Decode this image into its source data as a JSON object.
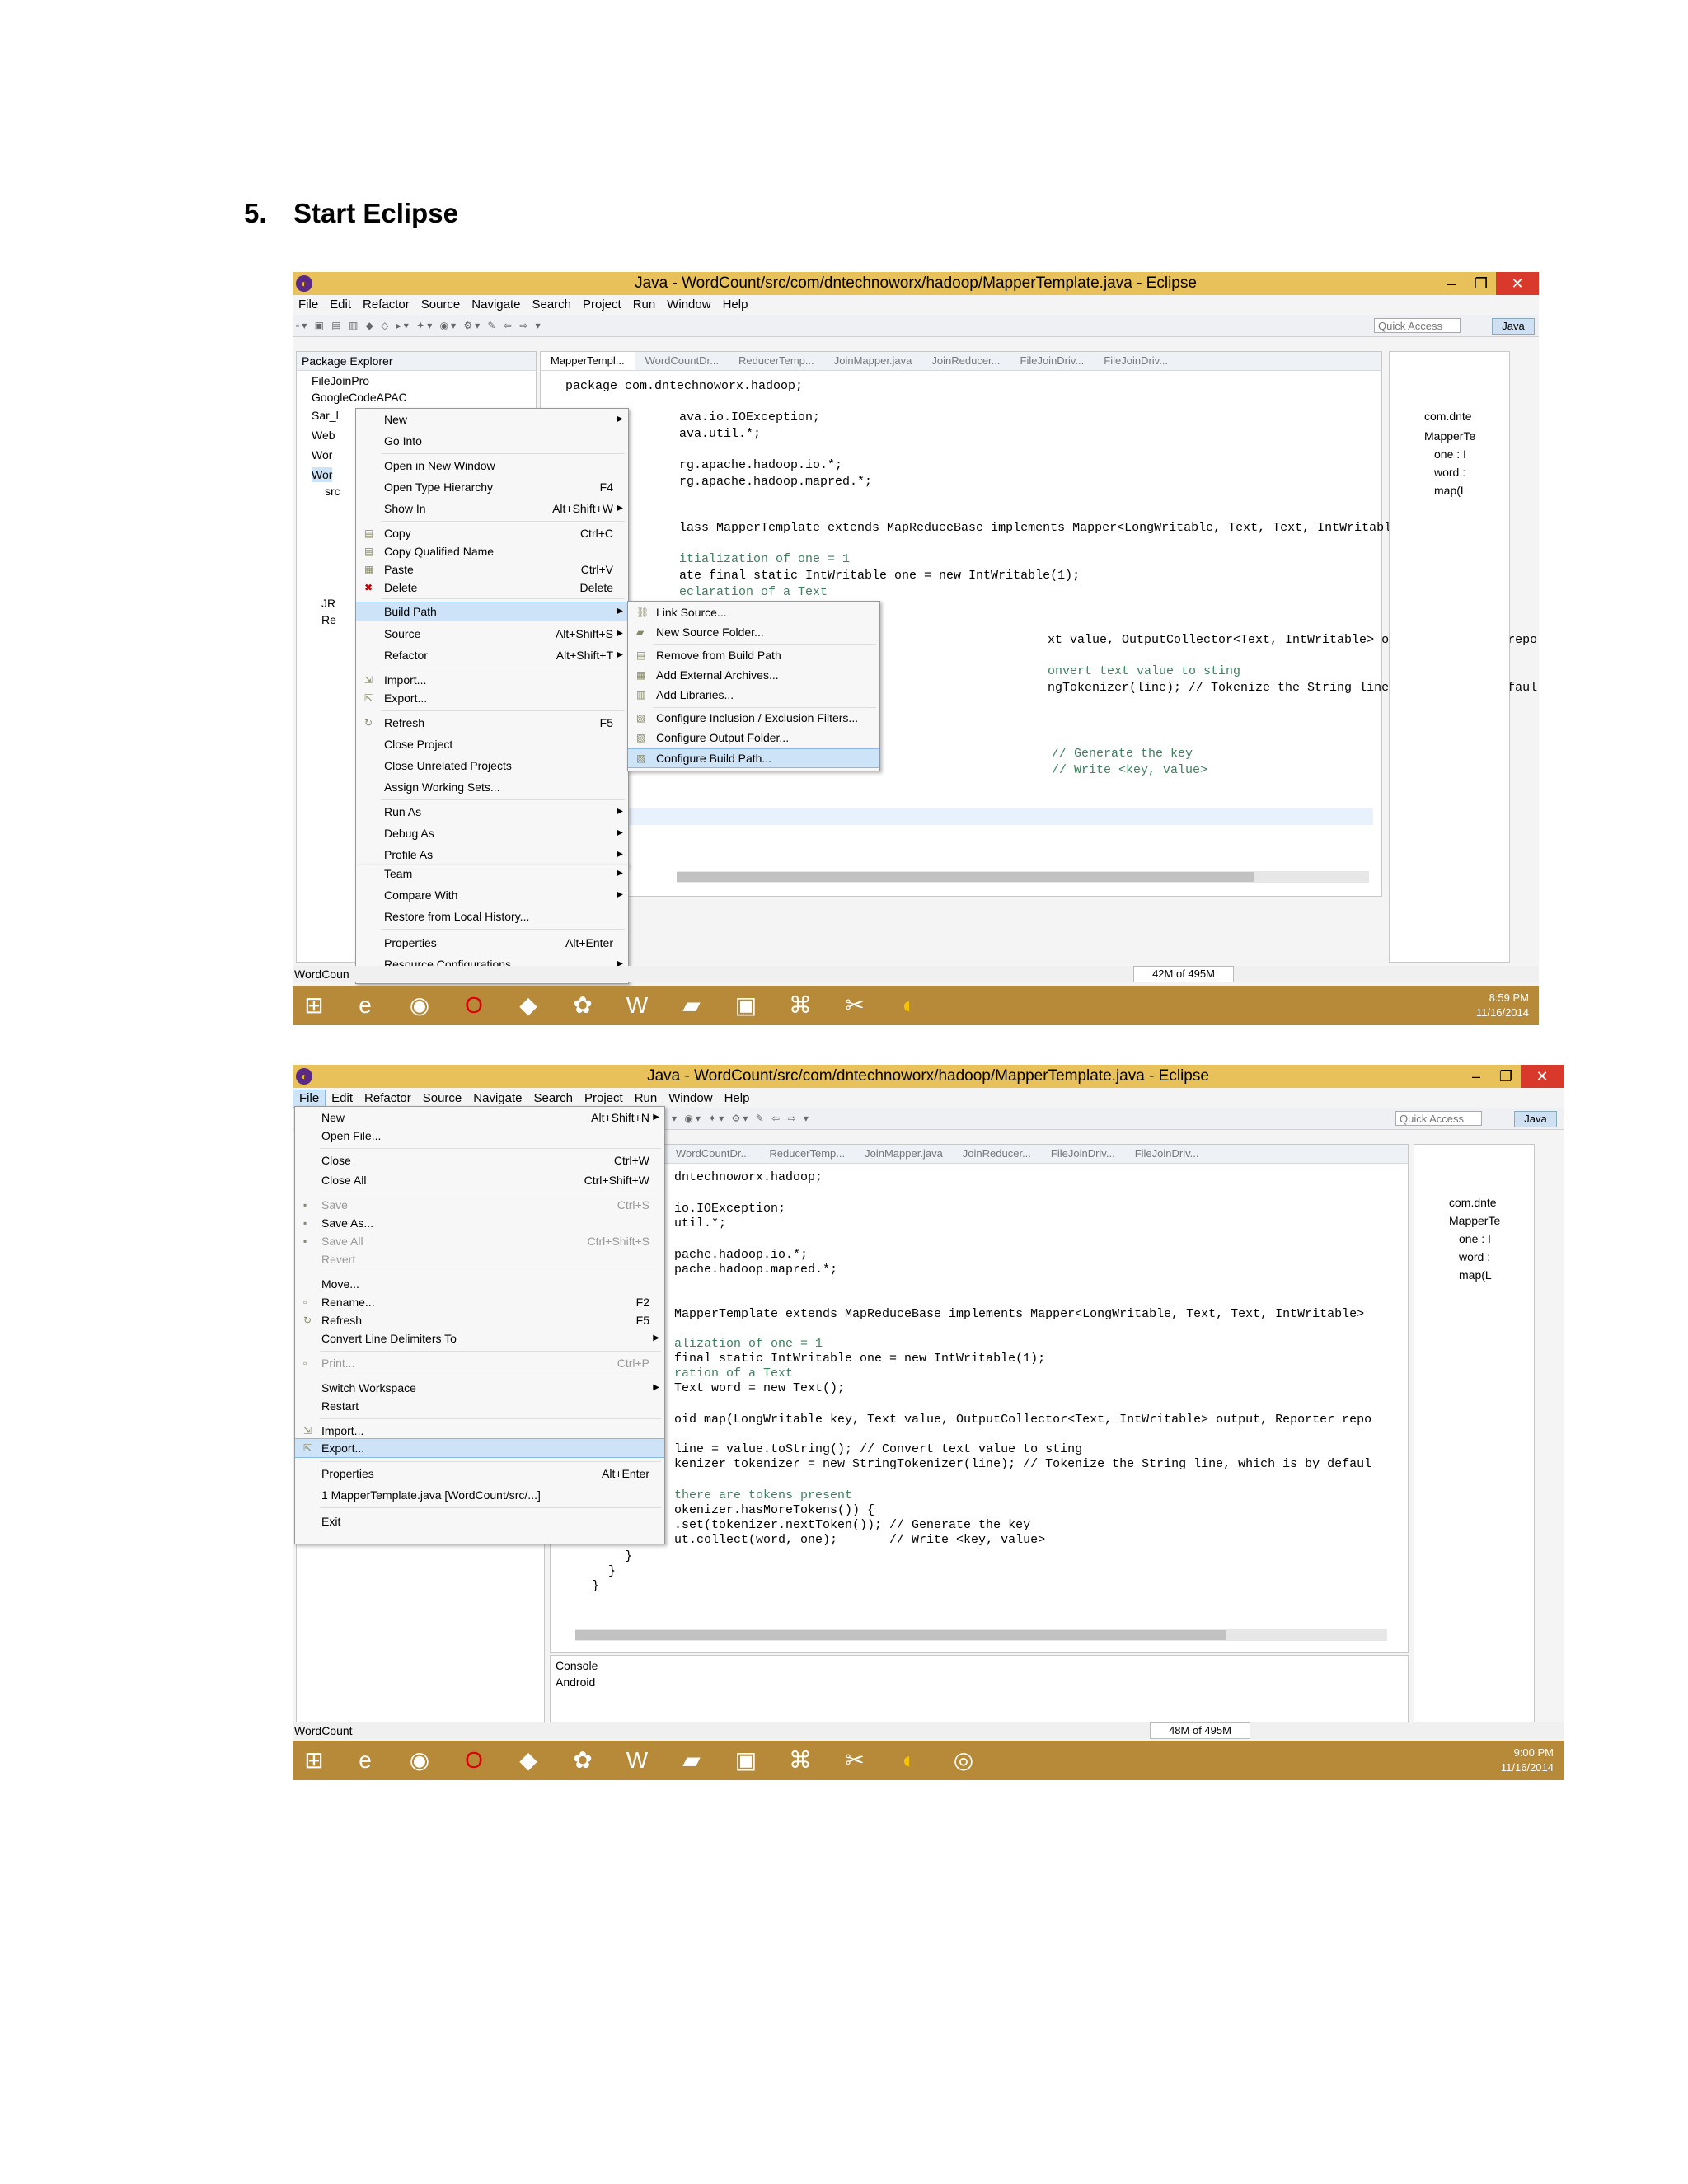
{
  "heading": {
    "number": "5.",
    "text": "Start Eclipse"
  },
  "shot1": {
    "title": "Java - WordCount/src/com/dntechnoworx/hadoop/MapperTemplate.java - Eclipse",
    "menubar": [
      "File",
      "Edit",
      "Refactor",
      "Source",
      "Navigate",
      "Search",
      "Project",
      "Run",
      "Window",
      "Help"
    ],
    "quick_access": "Quick Access",
    "perspective": "Java",
    "package_explorer": "Package Explorer",
    "tree": [
      "FileJoinPro",
      "GoogleCodeAPAC",
      "Sar_l",
      "Web",
      "Wor",
      "Wor",
      "src",
      "JR",
      "Re"
    ],
    "tabs": [
      "MapperTempl...",
      "WordCountDr...",
      "ReducerTemp...",
      "JoinMapper.java",
      "JoinReducer...",
      "FileJoinDriv...",
      "FileJoinDriv..."
    ],
    "code": [
      "package com.dntechnoworx.hadoop;",
      "ava.io.IOException;",
      "ava.util.*;",
      "rg.apache.hadoop.io.*;",
      "rg.apache.hadoop.mapred.*;",
      "lass MapperTemplate extends MapReduceBase implements Mapper<LongWritable, Text, Text, IntWritable>",
      "itialization of one = 1",
      "ate final static IntWritable one = new IntWritable(1);",
      "eclaration of a Text",
      "xt value, OutputCollector<Text, IntWritable> output, Reporter repo",
      "onvert text value to sting",
      "ngTokenizer(line); // Tokenize the String line, which is by defaul",
      "// Generate the key",
      "// Write <key, value>"
    ],
    "context_menu": [
      {
        "label": "New",
        "shortcut": "",
        "submenu": true
      },
      {
        "label": "Go Into",
        "shortcut": ""
      },
      {
        "label": "Open in New Window",
        "shortcut": ""
      },
      {
        "label": "Open Type Hierarchy",
        "shortcut": "F4"
      },
      {
        "label": "Show In",
        "shortcut": "Alt+Shift+W",
        "submenu": true
      },
      {
        "label": "Copy",
        "shortcut": "Ctrl+C"
      },
      {
        "label": "Copy Qualified Name",
        "shortcut": ""
      },
      {
        "label": "Paste",
        "shortcut": "Ctrl+V"
      },
      {
        "label": "Delete",
        "shortcut": "Delete"
      },
      {
        "label": "Build Path",
        "shortcut": "",
        "submenu": true
      },
      {
        "label": "Source",
        "shortcut": "Alt+Shift+S",
        "submenu": true
      },
      {
        "label": "Refactor",
        "shortcut": "Alt+Shift+T",
        "submenu": true
      },
      {
        "label": "Import...",
        "shortcut": ""
      },
      {
        "label": "Export...",
        "shortcut": ""
      },
      {
        "label": "Refresh",
        "shortcut": "F5"
      },
      {
        "label": "Close Project",
        "shortcut": ""
      },
      {
        "label": "Close Unrelated Projects",
        "shortcut": ""
      },
      {
        "label": "Assign Working Sets...",
        "shortcut": ""
      },
      {
        "label": "Run As",
        "shortcut": "",
        "submenu": true
      },
      {
        "label": "Debug As",
        "shortcut": "",
        "submenu": true
      },
      {
        "label": "Profile As",
        "shortcut": "",
        "submenu": true
      },
      {
        "label": "Team",
        "shortcut": "",
        "submenu": true
      },
      {
        "label": "Compare With",
        "shortcut": "",
        "submenu": true
      },
      {
        "label": "Restore from Local History...",
        "shortcut": ""
      },
      {
        "label": "Properties",
        "shortcut": "Alt+Enter"
      },
      {
        "label": "Resource Configurations",
        "shortcut": "",
        "submenu": true
      }
    ],
    "build_path_menu": [
      "Link Source...",
      "New Source Folder...",
      "Remove from Build Path",
      "Add External Archives...",
      "Add Libraries...",
      "Configure Inclusion / Exclusion Filters...",
      "Configure Output Folder...",
      "Configure Build Path..."
    ],
    "outline": [
      "com.dnte",
      "MapperTe",
      "one : I",
      "word :",
      "map(L"
    ],
    "status_left": "WordCoun",
    "memory": "42M of 495M",
    "clock_time": "8:59 PM",
    "clock_date": "11/16/2014"
  },
  "shot2": {
    "title": "Java - WordCount/src/com/dntechnoworx/hadoop/MapperTemplate.java - Eclipse",
    "menubar": [
      "File",
      "Edit",
      "Refactor",
      "Source",
      "Navigate",
      "Search",
      "Project",
      "Run",
      "Window",
      "Help"
    ],
    "quick_access": "Quick Access",
    "perspective": "Java",
    "tabs": [
      "WordCountDr...",
      "ReducerTemp...",
      "JoinMapper.java",
      "JoinReducer...",
      "FileJoinDriv...",
      "FileJoinDriv..."
    ],
    "code": [
      "dntechnoworx.hadoop;",
      "io.IOException;",
      "util.*;",
      "pache.hadoop.io.*;",
      "pache.hadoop.mapred.*;",
      "MapperTemplate extends MapReduceBase implements Mapper<LongWritable, Text, Text, IntWritable>",
      "alization of one = 1",
      "final static IntWritable one = new IntWritable(1);",
      "ration of a Text",
      "Text word = new Text();",
      "oid map(LongWritable key, Text value, OutputCollector<Text, IntWritable> output, Reporter repo",
      "line = value.toString(); // Convert text value to sting",
      "kenizer tokenizer = new StringTokenizer(line); // Tokenize the String line, which is by defaul",
      "there are tokens present",
      "okenizer.hasMoreTokens()) {",
      ".set(tokenizer.nextToken()); // Generate the key",
      "ut.collect(word, one);       // Write <key, value>",
      "}",
      "}",
      "}"
    ],
    "file_menu": [
      {
        "label": "New",
        "shortcut": "Alt+Shift+N",
        "submenu": true
      },
      {
        "label": "Open File...",
        "shortcut": ""
      },
      {
        "label": "Close",
        "shortcut": "Ctrl+W"
      },
      {
        "label": "Close All",
        "shortcut": "Ctrl+Shift+W"
      },
      {
        "label": "Save",
        "shortcut": "Ctrl+S",
        "disabled": true
      },
      {
        "label": "Save As...",
        "shortcut": ""
      },
      {
        "label": "Save All",
        "shortcut": "Ctrl+Shift+S",
        "disabled": true
      },
      {
        "label": "Revert",
        "shortcut": "",
        "disabled": true
      },
      {
        "label": "Move...",
        "shortcut": ""
      },
      {
        "label": "Rename...",
        "shortcut": "F2"
      },
      {
        "label": "Refresh",
        "shortcut": "F5"
      },
      {
        "label": "Convert Line Delimiters To",
        "shortcut": "",
        "submenu": true
      },
      {
        "label": "Print...",
        "shortcut": "Ctrl+P",
        "disabled": true
      },
      {
        "label": "Switch Workspace",
        "shortcut": "",
        "submenu": true
      },
      {
        "label": "Restart",
        "shortcut": ""
      },
      {
        "label": "Import...",
        "shortcut": ""
      },
      {
        "label": "Export...",
        "shortcut": ""
      },
      {
        "label": "Properties",
        "shortcut": "Alt+Enter"
      },
      {
        "label": "1 MapperTemplate.java  [WordCount/src/...]",
        "shortcut": ""
      },
      {
        "label": "Exit",
        "shortcut": ""
      }
    ],
    "outline": [
      "com.dnte",
      "MapperTe",
      "one : I",
      "word :",
      "map(L"
    ],
    "console": "Console",
    "console_text": "Android",
    "status_left": "WordCount",
    "memory": "48M of 495M",
    "clock_time": "9:00 PM",
    "clock_date": "11/16/2014"
  }
}
